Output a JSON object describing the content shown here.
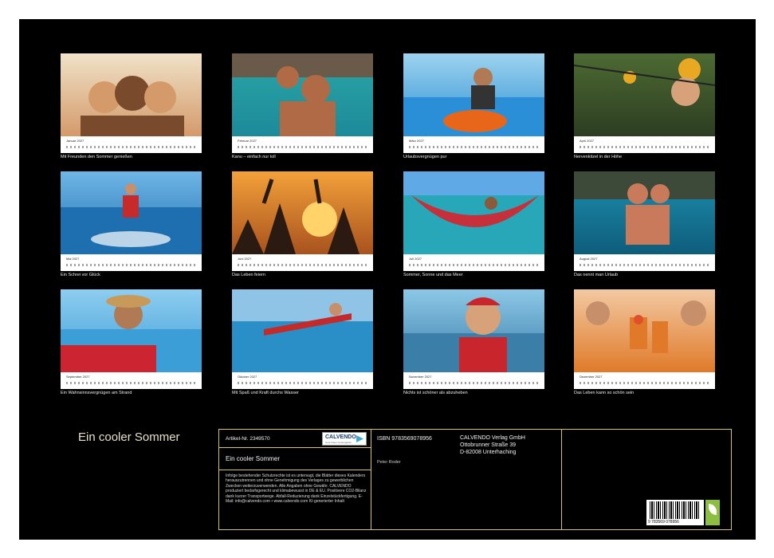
{
  "calendar_title": "Ein cooler Sommer",
  "months": [
    {
      "month": "Januar 2027",
      "caption": "Mit Freunden den Sommer genießen",
      "scene": "friends-selfie",
      "colors": [
        "#f0e2c8",
        "#d49a6a",
        "#7a4a2c"
      ]
    },
    {
      "month": "Februar 2027",
      "caption": "Kanu – einfach nur toll",
      "scene": "canoe-selfie",
      "colors": [
        "#2aa6a6",
        "#1d8a9a",
        "#b06a46"
      ]
    },
    {
      "month": "März 2027",
      "caption": "Urlaubsvergnügen pur",
      "scene": "jet-ski",
      "colors": [
        "#9ed3ee",
        "#2a8fd6",
        "#e8661a"
      ]
    },
    {
      "month": "April 2027",
      "caption": "Nervenkitzel in der Höhe",
      "scene": "zipline-helmets",
      "colors": [
        "#4d6a32",
        "#2c3d22",
        "#e8a822"
      ]
    },
    {
      "month": "Mai 2027",
      "caption": "Ein Schrei vor Glück",
      "scene": "water-skiing",
      "colors": [
        "#6fb6e6",
        "#1e6fb0",
        "#c62a2a"
      ]
    },
    {
      "month": "Juni 2027",
      "caption": "Das Leben feiern",
      "scene": "beach-party-sunset",
      "colors": [
        "#f3a13a",
        "#a8521e",
        "#2a1a12"
      ]
    },
    {
      "month": "Juli 2027",
      "caption": "Sommer, Sonne und das Meer",
      "scene": "hammock-over-sea",
      "colors": [
        "#7fd6e6",
        "#27a7b7",
        "#c6303a"
      ]
    },
    {
      "month": "August 2027",
      "caption": "Das nennt man Urlaub",
      "scene": "couple-swimming",
      "colors": [
        "#1f8fb0",
        "#0d5d7a",
        "#c97a5a"
      ]
    },
    {
      "month": "September 2027",
      "caption": "Ein Wahnsinnsvergnügen am Strand",
      "scene": "man-on-jetski",
      "colors": [
        "#8ecdf0",
        "#3c9ed6",
        "#cc2430"
      ]
    },
    {
      "month": "Oktober 2027",
      "caption": "Mit Spaß und Kraft durchs Wasser",
      "scene": "kayak-splash",
      "colors": [
        "#d8eef7",
        "#2a8fc6",
        "#c42a2a"
      ]
    },
    {
      "month": "November 2027",
      "caption": "Nichts ist schöner als abzuheben",
      "scene": "paragliding-woman",
      "colors": [
        "#8cc7e6",
        "#3b7ea8",
        "#c8262c"
      ]
    },
    {
      "month": "Dezember 2027",
      "caption": "Das Leben kann so schön sein",
      "scene": "friends-with-drinks",
      "colors": [
        "#f2c9a2",
        "#e07a2a",
        "#8a3a2a"
      ]
    }
  ],
  "info": {
    "article_label": "Artikel-Nr. 2349570",
    "publisher_logo": "CALVENDO",
    "publisher_logo_sub": "Gute Ideen herausgeben",
    "isbn": "ISBN 9783569078956",
    "publisher_name": "CALVENDO Verlag GmbH",
    "publisher_street": "Ottobrunner Straße 39",
    "publisher_city": "D-82008 Unterhaching",
    "product_title": "Ein cooler Sommer",
    "author": "Peter Roder",
    "notice": "Infolge bestehender Schutzrechte ist es untersagt, die Blätter dieses Kalenders herauszutrennen und ohne Genehmigung des Verlages zu gewerblichen Zwecken weiterzuverwenden. Alle Angaben ohne Gewähr. CALVENDO produziert bedarfsgerecht und klimabewusst in DE & EU. Positivere CO2-Bilanz dank kurzer Transportwege. Abfall-Reduzierung dank Einzelstückfertigung. E-Mail: info@calvendo.com • www.calvendo.com KI-generierter Inhalt",
    "barcode_number": "9 783569 078956",
    "eco_badge": "ECO"
  },
  "theme": {
    "background": "#000000",
    "accent": "#d8c26a",
    "page": "#ffffff"
  }
}
